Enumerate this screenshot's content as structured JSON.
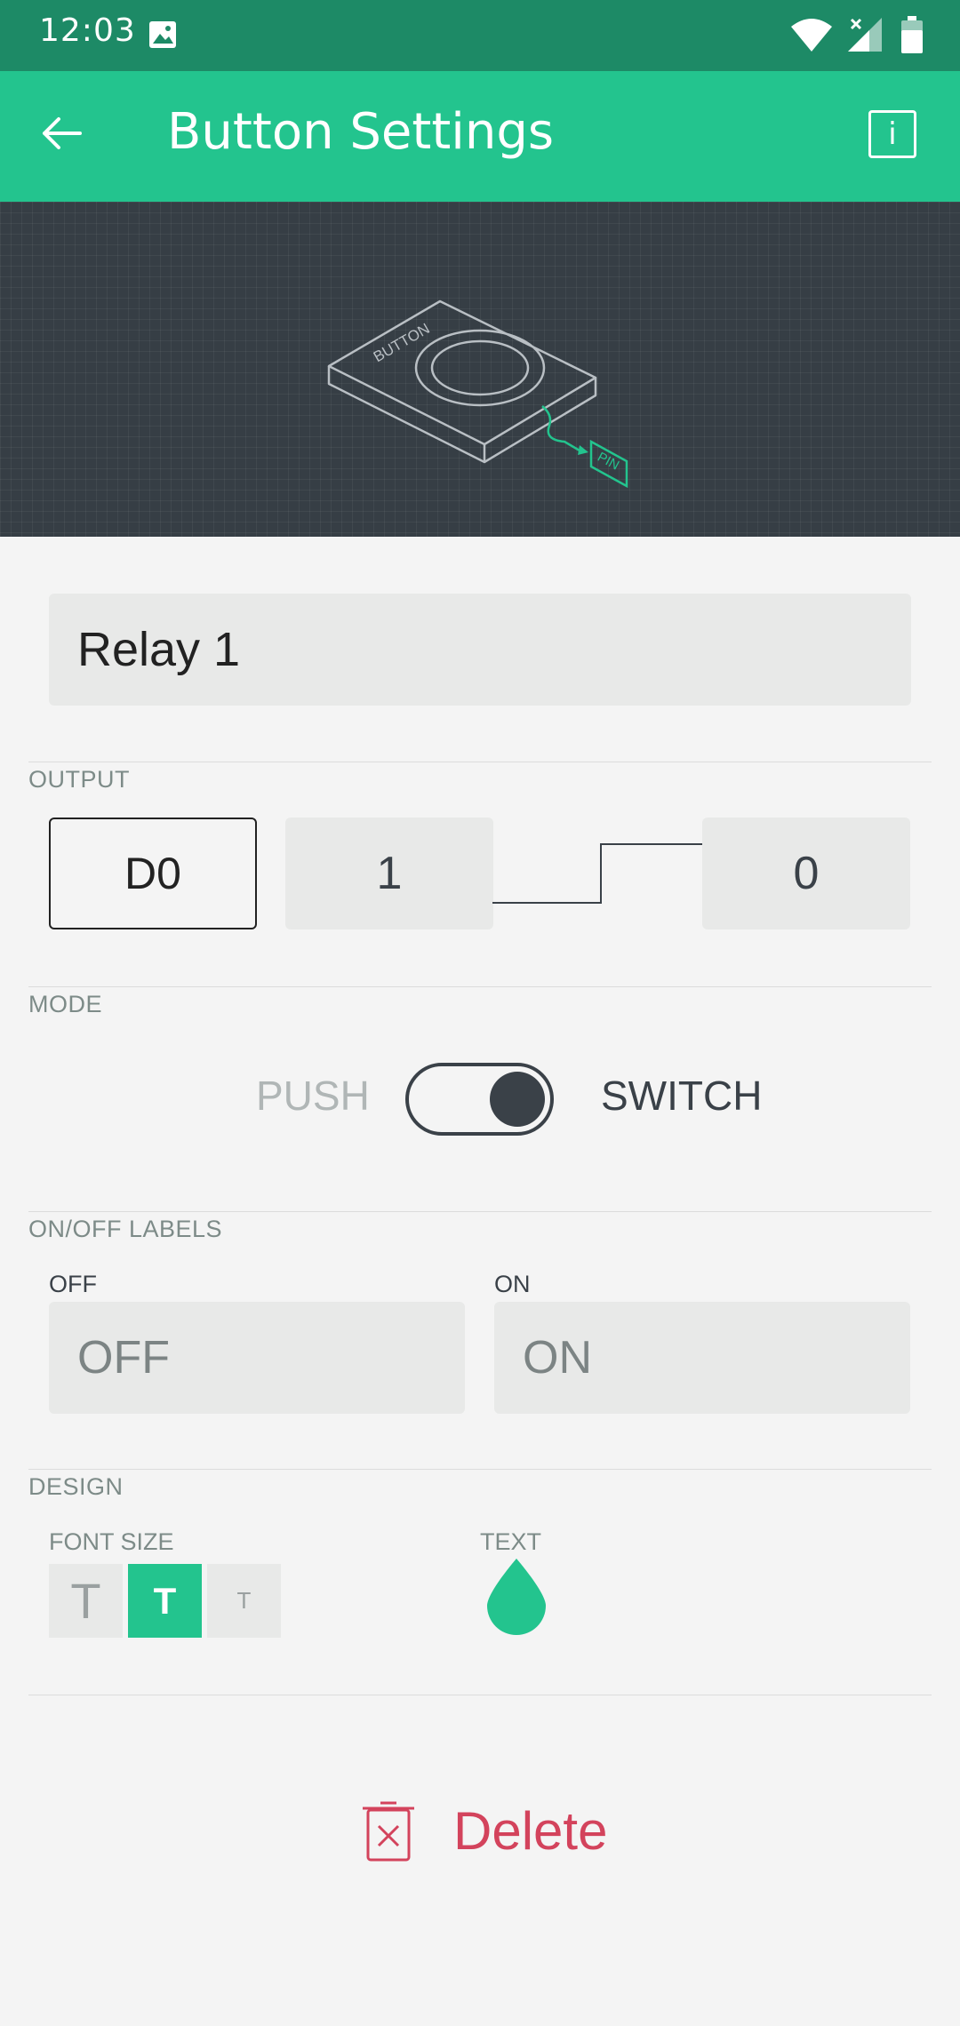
{
  "status_bar": {
    "time": "12:03",
    "icons": [
      "image-icon",
      "wifi-icon",
      "signal-icon",
      "battery-icon"
    ]
  },
  "app_bar": {
    "title": "Button Settings",
    "back_icon": "arrow-left-icon",
    "info_icon": "info-icon",
    "info_glyph": "i"
  },
  "hero": {
    "device_label": "BUTTON",
    "pin_label": "PIN"
  },
  "name_field": {
    "value": "Relay 1"
  },
  "output": {
    "section_label": "OUTPUT",
    "pin": "D0",
    "high_value": "1",
    "low_value": "0"
  },
  "mode": {
    "section_label": "MODE",
    "push_label": "PUSH",
    "switch_label": "SWITCH",
    "selected": "SWITCH"
  },
  "labels": {
    "section_label": "ON/OFF LABELS",
    "off_caption": "OFF",
    "on_caption": "ON",
    "off_value": "OFF",
    "on_value": "ON"
  },
  "design": {
    "section_label": "DESIGN",
    "font_size_label": "FONT SIZE",
    "font_sizes": [
      {
        "glyph": "T",
        "selected": false
      },
      {
        "glyph": "T",
        "selected": true
      },
      {
        "glyph": "T",
        "selected": false
      }
    ],
    "text_label": "TEXT",
    "text_color": "#23c48e"
  },
  "delete_button": {
    "label": "Delete",
    "icon": "trash-icon",
    "color": "#d3435c"
  },
  "colors": {
    "accent": "#23c48e",
    "status_bar": "#1d8a66",
    "hero_bg": "#363e45",
    "danger": "#d3435c"
  }
}
